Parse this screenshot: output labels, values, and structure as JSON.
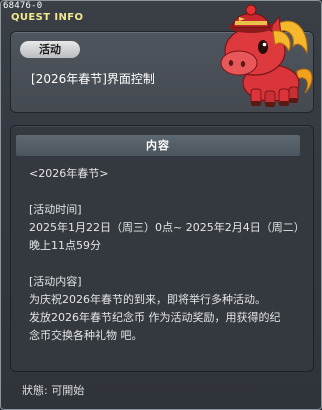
{
  "window": {
    "id": "68476-0",
    "title": "QUEST INFO"
  },
  "header": {
    "category_label": "活动",
    "quest_name": "[2026年春节]界面控制"
  },
  "mascot": {
    "icon": "red-horse-mascot-icon",
    "colors": {
      "body": "#d9353a",
      "mane": "#f2a11e",
      "hat": "#c8282c"
    }
  },
  "content": {
    "header_label": "内容",
    "lines": [
      "<2026年春节>",
      "",
      "[活动时间]",
      "2025年1月22日（周三）0点~ 2025年2月4日（周二）",
      "晚上11点59分",
      "",
      "[活动内容]",
      "为庆祝2026年春节的到来，即将举行多种活动。",
      "发放2026年春节纪念币 作为活动奖励，用获得的纪",
      "念币交换各种礼物 吧。"
    ]
  },
  "status": {
    "text": "狀態: 可開始"
  }
}
